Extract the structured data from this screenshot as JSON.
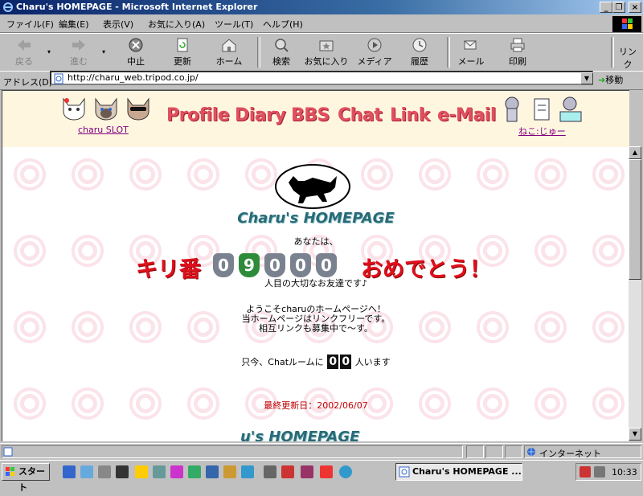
{
  "window": {
    "title": "Charu's HOMEPAGE - Microsoft Internet Explorer"
  },
  "menu": [
    "ファイル(F)",
    "編集(E)",
    "表示(V)",
    "お気に入り(A)",
    "ツール(T)",
    "ヘルプ(H)"
  ],
  "toolbar": {
    "back": "戻る",
    "forward": "進む",
    "stop": "中止",
    "refresh": "更新",
    "home": "ホーム",
    "search": "検索",
    "favorites": "お気に入り",
    "media": "メディア",
    "history": "履歴",
    "mail": "メール",
    "print": "印刷",
    "links": "リンク"
  },
  "address": {
    "label": "アドレス(D)",
    "url": "http://charu_web.tripod.co.jp/",
    "go": "移動"
  },
  "page": {
    "header": {
      "slot_link": "charu SLOT",
      "nav": [
        "Profile",
        "Diary",
        "BBS",
        "Chat",
        "Link",
        "e-Mail"
      ],
      "mouse_link": "ねこ:じゅー"
    },
    "logo_text": "Charu's HOMEPAGE",
    "you_are": "あなたは、",
    "kiriban_label": "キリ番",
    "kiriban_digits": [
      "0",
      "9",
      "0",
      "0",
      "0"
    ],
    "congrats": "おめでとう！",
    "friend_line": "人目の大切なお友達です♪",
    "welcome": [
      "ようこそcharuのホームページへ！",
      "当ホームページはリンクフリーです。",
      "相互リンクも募集中で〜す。"
    ],
    "chat_prefix": "只今、Chatルームに",
    "chat_count": [
      "0",
      "0"
    ],
    "chat_suffix": "人います",
    "updated": "最終更新日：2002/06/07",
    "footer_logo": "u's HOMEPAGE"
  },
  "status": {
    "zone": "インターネット"
  },
  "taskbar": {
    "start": "スタート",
    "active_task": "Charu's HOMEPAGE ...",
    "clock": "10:33"
  },
  "colors": {
    "nav": "#e05060",
    "kiriban": "#e0101c",
    "logo": "#2a6a78",
    "updated": "#c00000"
  }
}
